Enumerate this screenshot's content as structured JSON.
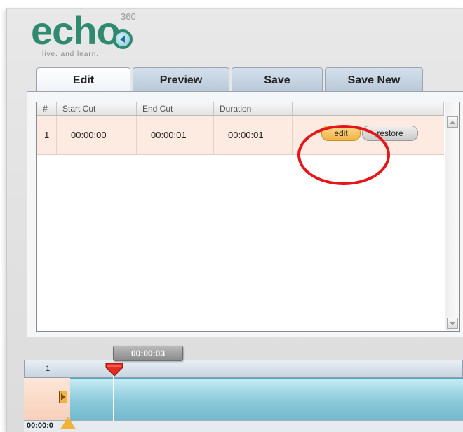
{
  "logo": {
    "wordmark": "echo",
    "superscript": "360",
    "tagline": "live. and learn."
  },
  "tabs": [
    {
      "label": "Edit",
      "active": true
    },
    {
      "label": "Preview",
      "active": false
    },
    {
      "label": "Save",
      "active": false
    },
    {
      "label": "Save New",
      "active": false
    }
  ],
  "table": {
    "headers": [
      "#",
      "Start Cut",
      "End Cut",
      "Duration",
      ""
    ],
    "rows": [
      {
        "num": "1",
        "start": "00:00:00",
        "end": "00:00:01",
        "duration": "00:00:01",
        "edit_label": "edit",
        "restore_label": "restore"
      }
    ]
  },
  "timeline": {
    "playhead_time": "00:00:03",
    "ruler_label": "1",
    "left_time": "00:00:0"
  },
  "colors": {
    "accent": "#2f8a6f",
    "edit_button": "#f0b347",
    "highlight_circle": "#e3161a",
    "row_bg": "#fdebe2",
    "track": "#8ac9da"
  },
  "icons": [
    "logo-speaker-icon",
    "scroll-up-icon",
    "scroll-down-icon",
    "clip-start-bracket-icon",
    "playhead-marker-icon",
    "in-point-marker-icon"
  ]
}
